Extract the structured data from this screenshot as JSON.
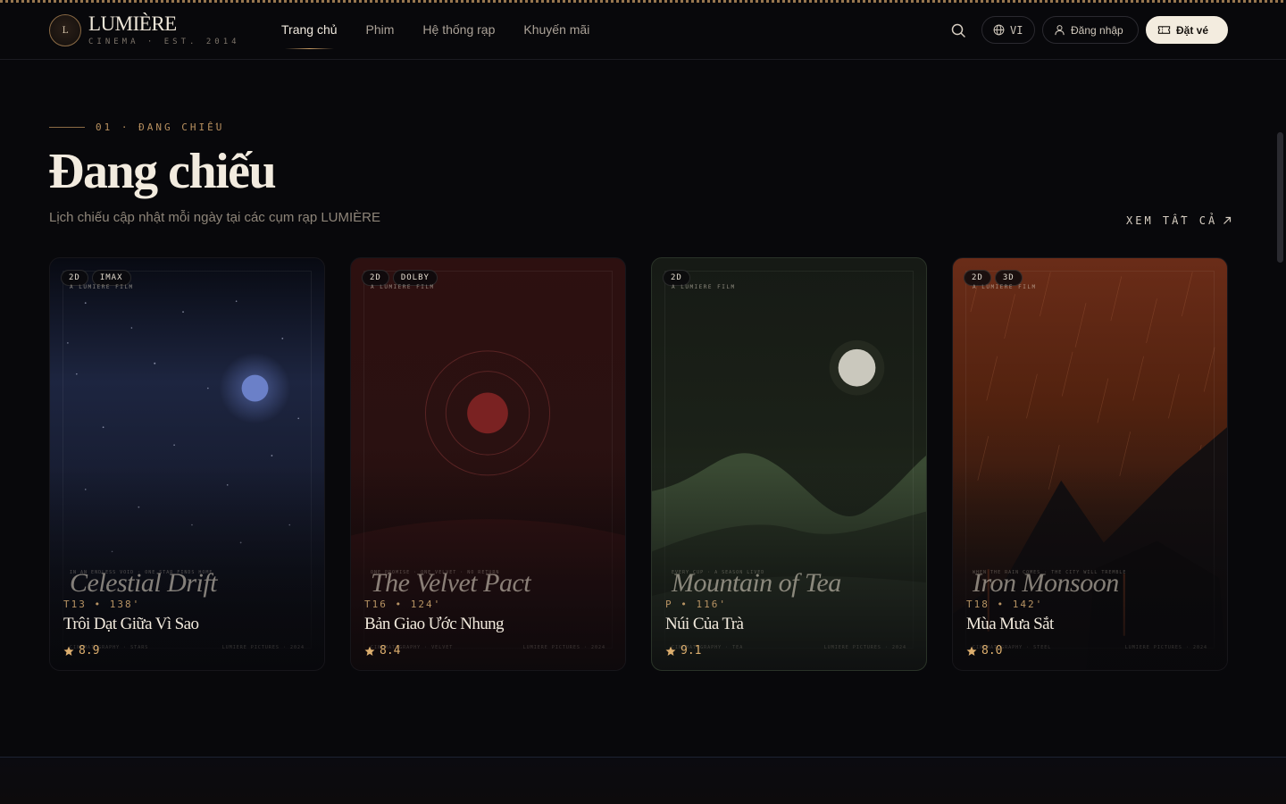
{
  "brand": {
    "mark": "L",
    "name": "LUMIÈRE",
    "tagline": "CINEMA · EST. 2014"
  },
  "nav": {
    "items": [
      {
        "label": "Trang chủ",
        "active": true
      },
      {
        "label": "Phim",
        "active": false
      },
      {
        "label": "Hệ thống rạp",
        "active": false
      },
      {
        "label": "Khuyến mãi",
        "active": false
      }
    ]
  },
  "header_actions": {
    "search_icon": "search-icon",
    "language": "VI",
    "login": "Đăng nhập",
    "book": "Đặt vé"
  },
  "section": {
    "eyebrow": "01 · ĐANG CHIẾU",
    "title": "Đang chiếu",
    "description": "Lịch chiếu cập nhật mỗi ngày tại các cụm rạp LUMIÈRE",
    "see_all": "XEM TẤT CẢ"
  },
  "movies": [
    {
      "tags": [
        "2D",
        "IMAX"
      ],
      "studio": "A LUMIERE FILM",
      "tagline": "IN AN ENDLESS VOID · ONE STAR FINDS HOME",
      "poster_title": "Celestial Drift",
      "credits_left": "CINEMATOGRAPHY · STARS",
      "credits_right": "LUMIERE PICTURES · 2024",
      "meta": "T13 • 138'",
      "title": "Trôi Dạt Giữa Vì Sao",
      "rating": "8.9",
      "theme": "#1a2238"
    },
    {
      "tags": [
        "2D",
        "DOLBY"
      ],
      "studio": "A LUMIERE FILM",
      "tagline": "ONE PROMISE · ONE VELVET · NO RETURN",
      "poster_title": "The Velvet Pact",
      "credits_left": "CINEMATOGRAPHY · VELVET",
      "credits_right": "LUMIERE PICTURES · 2024",
      "meta": "T16 • 124'",
      "title": "Bản Giao Ước Nhung",
      "rating": "8.4",
      "theme": "#3a1414"
    },
    {
      "tags": [
        "2D"
      ],
      "studio": "A LUMIERE FILM",
      "tagline": "EVERY CUP · A SEASON LIVED",
      "poster_title": "Mountain of Tea",
      "credits_left": "CINEMATOGRAPHY · TEA",
      "credits_right": "LUMIERE PICTURES · 2024",
      "meta": "P • 116'",
      "title": "Núi Của Trà",
      "rating": "9.1",
      "theme": "#1c2219"
    },
    {
      "tags": [
        "2D",
        "3D"
      ],
      "studio": "A LUMIERE FILM",
      "tagline": "WHEN THE RAIN COMES · THE CITY WILL TREMBLE",
      "poster_title": "Iron Monsoon",
      "credits_left": "CINEMATOGRAPHY · STEEL",
      "credits_right": "LUMIERE PICTURES · 2024",
      "meta": "T18 • 142'",
      "title": "Mùa Mưa Sắt",
      "rating": "8.0",
      "theme": "#5a2414"
    }
  ]
}
